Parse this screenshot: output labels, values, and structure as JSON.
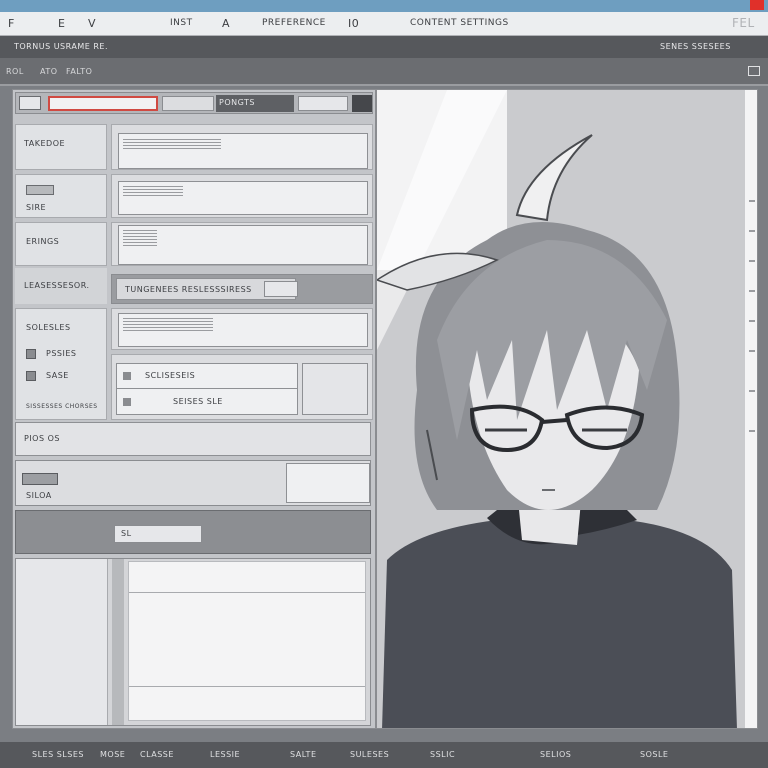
{
  "menubar": {
    "items": [
      "F",
      "E",
      "V",
      "INST",
      "A",
      "PREFERENCE",
      "I0",
      "CONTENT SETTINGS"
    ],
    "right_label": "FEL"
  },
  "title_strip": {
    "left_text": "TORNUS USRAME RE.",
    "right_text": "SENES SSESEES"
  },
  "subbar": {
    "items": [
      "ROL",
      "ATO",
      "FALTO"
    ]
  },
  "form": {
    "toolbar_label": "PONGTS",
    "rows": [
      {
        "label": "TAKEDOE",
        "sublabel": ""
      },
      {
        "label": "",
        "sublabel": "SIRE"
      },
      {
        "label": "ERINGS",
        "sublabel": ""
      },
      {
        "label": "LEASESSESOR.",
        "sublabel": ""
      },
      {
        "label": "SOLESLES",
        "sublabel": ""
      }
    ],
    "row4_field_text": "TUNGENEES RESLESSSIRESS",
    "checks": [
      {
        "label": "PSSIES",
        "text": "SCLISESEIS"
      },
      {
        "label": "SASE",
        "text": "SEISES SLE"
      }
    ],
    "footnote": "SISSESSES CHORSES",
    "section_label": "PIOS OS",
    "status_text": "SILOA",
    "strip_button": "SL"
  },
  "bottombar": {
    "items": [
      "SLES SLSES",
      "MOSE",
      "CLASSE",
      "LESSIE",
      "SALTE",
      "SULESES",
      "SSLIC",
      "SELIOS",
      "SOSLE"
    ]
  }
}
